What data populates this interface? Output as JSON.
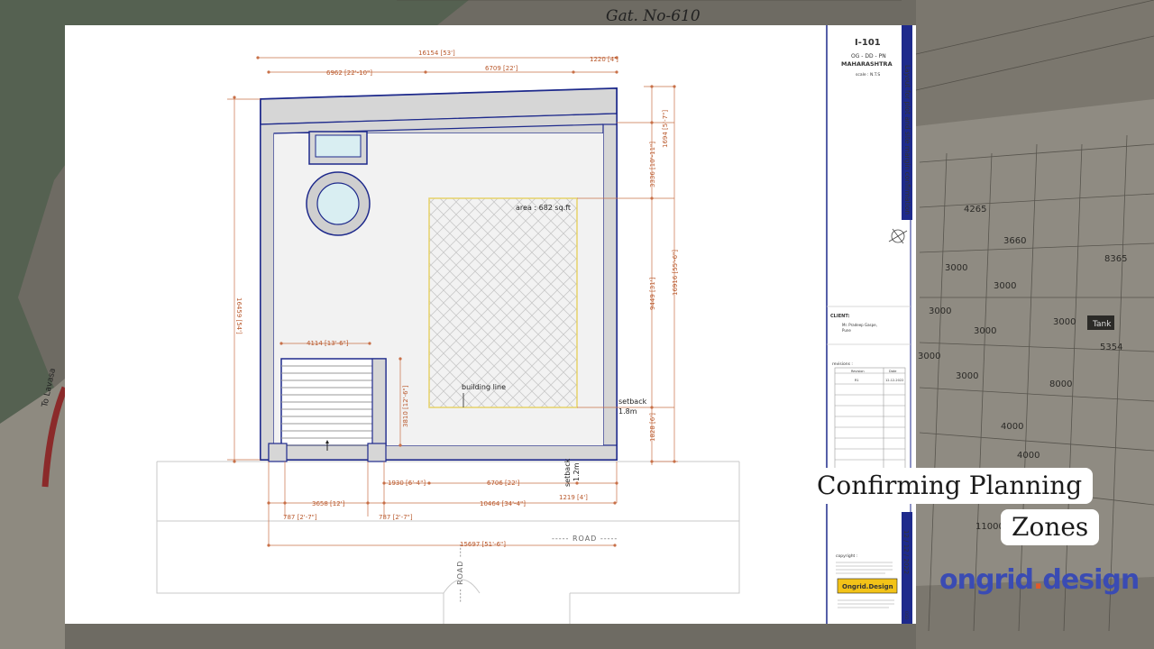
{
  "header": {
    "gat_no": "Gat. No-610"
  },
  "plan": {
    "area_label": "area : 682 sq.ft",
    "building_line": "building line",
    "setback_right_line1": "setback",
    "setback_right_line2": "1.8m",
    "setback_bottom_line1": "setback",
    "setback_bottom_line2": "1.2m",
    "road_bottom": "----- ROAD -----",
    "road_left": "---- ROAD ----",
    "dims": {
      "top_total": "16154 [53']",
      "top_a": "6962 [22'-10\"]",
      "top_b": "6709 [22']",
      "top_c": "1220 [4']",
      "right_a": "1694 [5'-7\"]",
      "right_b": "3336 [10'-11\"]",
      "right_c": "9449 [31']",
      "right_d": "1828 [6']",
      "right_total": "16916 [55'-6\"]",
      "left_total": "16459 [54']",
      "stair_width": "4114 [13'-6\"]",
      "stair_height": "3810 [12'-6\"]",
      "bottom_a": "1930 [6'-4\"]",
      "bottom_b": "6706 [22']",
      "bottom_c": "1219 [4']",
      "bottom_d": "3658 [12']",
      "bottom_e": "10464 [34'-4\"]",
      "bottom_f": "787 [2'-7\"]",
      "bottom_g": "787 [2'-7\"]",
      "bottom_total": "15697 [51'-6\"]"
    }
  },
  "title_block": {
    "sheet_no": "I-101",
    "code": "OG - DD - PN",
    "state": "MAHARASHTRA",
    "scale": "scale : N.T.S",
    "vertical_title": "Layout for plot and site margin confirmation",
    "client_label": "CLIENT:",
    "client_name_1": "Mr. Pradeep Gaspe,",
    "client_name_2": "Pune",
    "revision_label": "revisions :",
    "rev_col1": "Revision",
    "rev_col2": "Date",
    "rev_row1_a": "R1",
    "rev_row1_b": "12-12-2022",
    "date": "12 / 12 / 2022",
    "copyright": "copyright :",
    "logo_text": "Ongrid.Design",
    "sheet_tag": "OGD"
  },
  "map_labels": {
    "road_to": "To Lavasa",
    "tank": "Tank",
    "n4265": "4265",
    "n3660": "3660",
    "n3000a": "3000",
    "n3000b": "3000",
    "n3000c": "3000",
    "n3000d": "3000",
    "n3000e": "3000",
    "n3000f": "3000",
    "n3000g": "3000",
    "n3000h": "3000",
    "n8365": "8365",
    "n5354": "5354",
    "n8000": "8000",
    "n4000a": "4000",
    "n4000b": "4000",
    "n11000": "11000"
  },
  "caption": {
    "line1": "Confirming Planning",
    "line2": "Zones"
  },
  "brand": {
    "name_a": "ongrid",
    "dot": ".",
    "name_b": "design"
  }
}
